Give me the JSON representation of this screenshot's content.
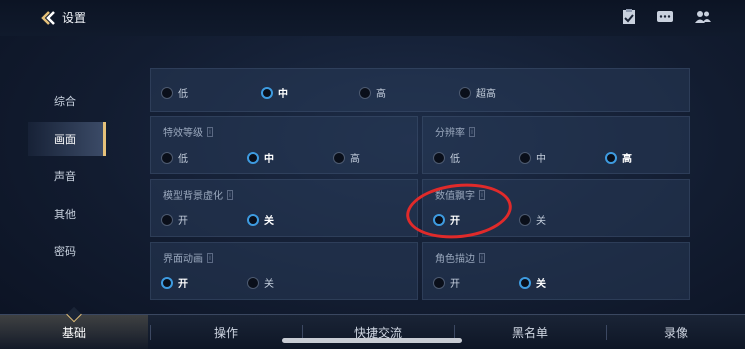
{
  "header": {
    "title": "设置"
  },
  "sidebar": {
    "items": [
      {
        "label": "综合"
      },
      {
        "label": "画面"
      },
      {
        "label": "声音"
      },
      {
        "label": "其他"
      },
      {
        "label": "密码"
      }
    ]
  },
  "settings": {
    "row0": {
      "title": "",
      "options": [
        "低",
        "中",
        "高",
        "超高"
      ],
      "selected": "中"
    },
    "effects_level": {
      "title": "特效等级",
      "options": [
        "低",
        "中",
        "高"
      ],
      "selected": "中"
    },
    "resolution": {
      "title": "分辨率",
      "options": [
        "低",
        "中",
        "高"
      ],
      "selected": "高"
    },
    "model_bg_blur": {
      "title": "模型背景虚化",
      "options": [
        "开",
        "关"
      ],
      "selected": "关"
    },
    "damage_numbers": {
      "title": "数值飘字",
      "options": [
        "开",
        "关"
      ],
      "selected": "开"
    },
    "ui_animation": {
      "title": "界面动画",
      "options": [
        "开",
        "关"
      ],
      "selected": "开"
    },
    "char_outline": {
      "title": "角色描边",
      "options": [
        "开",
        "关"
      ],
      "selected": "关"
    }
  },
  "bottom_tabs": [
    {
      "label": "基础"
    },
    {
      "label": "操作"
    },
    {
      "label": "快捷交流"
    },
    {
      "label": "黑名单"
    },
    {
      "label": "录像"
    }
  ],
  "colors": {
    "accent_gold": "#e6c27a",
    "radio_on": "#3e9be0",
    "annotation_red": "#e02a2a"
  }
}
